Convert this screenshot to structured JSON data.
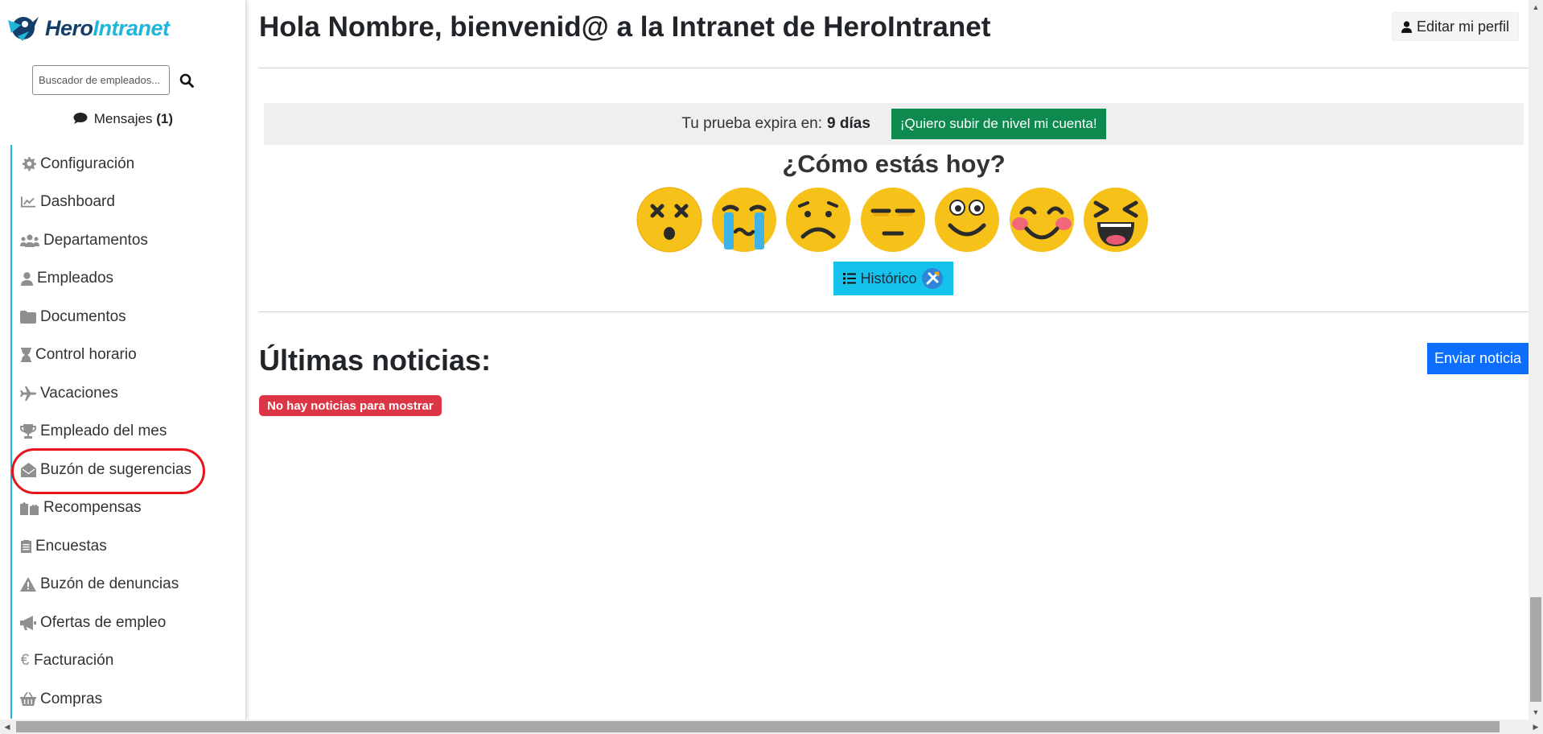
{
  "logo": {
    "part1": "Hero",
    "part2": "Intranet"
  },
  "search": {
    "placeholder": "Buscador de empleados..."
  },
  "messages": {
    "label": "Mensajes",
    "count": "(1)"
  },
  "sidebar": {
    "items": [
      {
        "label": "Configuración",
        "icon": "gear-icon"
      },
      {
        "label": "Dashboard",
        "icon": "chart-line-icon"
      },
      {
        "label": "Departamentos",
        "icon": "users-icon"
      },
      {
        "label": "Empleados",
        "icon": "user-icon"
      },
      {
        "label": "Documentos",
        "icon": "folder-icon"
      },
      {
        "label": "Control horario",
        "icon": "hourglass-icon"
      },
      {
        "label": "Vacaciones",
        "icon": "plane-icon"
      },
      {
        "label": "Empleado del mes",
        "icon": "trophy-icon"
      },
      {
        "label": "Buzón de sugerencias",
        "icon": "envelope-open-icon"
      },
      {
        "label": "Recompensas",
        "icon": "gifts-icon"
      },
      {
        "label": "Encuestas",
        "icon": "clipboard-icon"
      },
      {
        "label": "Buzón de denuncias",
        "icon": "warning-icon"
      },
      {
        "label": "Ofertas de empleo",
        "icon": "megaphone-icon"
      },
      {
        "label": "Facturación",
        "icon": "euro-icon"
      },
      {
        "label": "Compras",
        "icon": "basket-icon"
      }
    ]
  },
  "header": {
    "greeting_prefix": "Hola",
    "name": "Nombre",
    "greeting_mid": ", bienvenid@ a la Intranet de",
    "company": "HeroIntranet",
    "edit_profile": "Editar mi perfil"
  },
  "trial": {
    "text": "Tu prueba expira en:",
    "days": "9 días",
    "upgrade": "¡Quiero subir de nivel mi cuenta!"
  },
  "mood": {
    "title": "¿Cómo estás hoy?",
    "options": [
      "dizzy-face-icon",
      "crying-face-icon",
      "sad-face-icon",
      "neutral-face-icon",
      "smiling-face-icon",
      "blushing-face-icon",
      "laughing-face-icon"
    ],
    "history": "Histórico"
  },
  "news": {
    "title": "Últimas noticias:",
    "send": "Enviar noticia",
    "empty": "No hay noticias para mostrar"
  },
  "colors": {
    "brand_dark": "#143f6b",
    "brand_accent": "#1fb6d9",
    "upgrade": "#0e8a4f",
    "history": "#15c2ec",
    "primary": "#0d6efd",
    "danger": "#dc3545",
    "highlight": "#e8141c"
  }
}
